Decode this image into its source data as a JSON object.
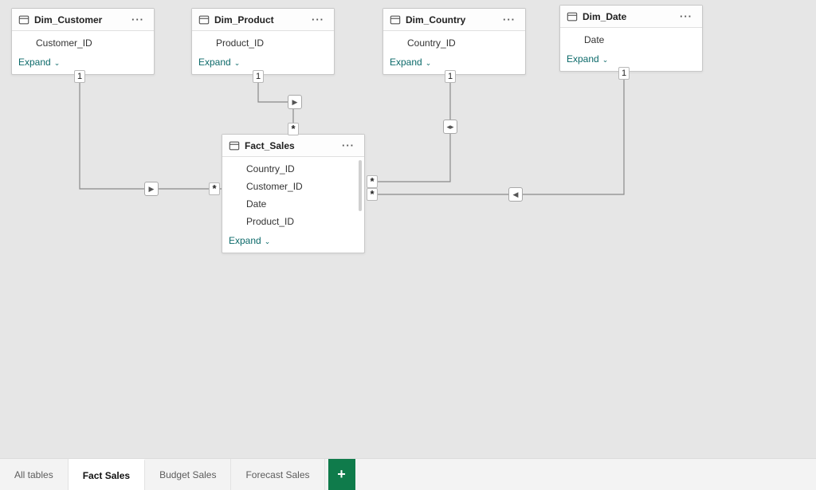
{
  "tables": {
    "dim_customer": {
      "title": "Dim_Customer",
      "fields": [
        "Customer_ID"
      ],
      "expand": "Expand"
    },
    "dim_product": {
      "title": "Dim_Product",
      "fields": [
        "Product_ID"
      ],
      "expand": "Expand"
    },
    "dim_country": {
      "title": "Dim_Country",
      "fields": [
        "Country_ID"
      ],
      "expand": "Expand"
    },
    "dim_date": {
      "title": "Dim_Date",
      "fields": [
        "Date"
      ],
      "expand": "Expand"
    },
    "fact_sales": {
      "title": "Fact_Sales",
      "fields": [
        "Country_ID",
        "Customer_ID",
        "Date",
        "Product_ID"
      ],
      "expand": "Expand"
    }
  },
  "relationships": [
    {
      "from": "dim_customer",
      "to": "fact_sales",
      "from_card": "1",
      "to_card": "*",
      "direction": "single"
    },
    {
      "from": "dim_product",
      "to": "fact_sales",
      "from_card": "1",
      "to_card": "*",
      "direction": "single"
    },
    {
      "from": "dim_country",
      "to": "fact_sales",
      "from_card": "1",
      "to_card": "*",
      "direction": "both"
    },
    {
      "from": "dim_date",
      "to": "fact_sales",
      "from_card": "1",
      "to_card": "*",
      "direction": "single"
    }
  ],
  "cardinality": {
    "one": "1",
    "many": "*"
  },
  "tabs": {
    "items": [
      {
        "label": "All tables",
        "active": false
      },
      {
        "label": "Fact Sales",
        "active": true
      },
      {
        "label": "Budget Sales",
        "active": false
      },
      {
        "label": "Forecast Sales",
        "active": false
      }
    ],
    "add": "+"
  }
}
